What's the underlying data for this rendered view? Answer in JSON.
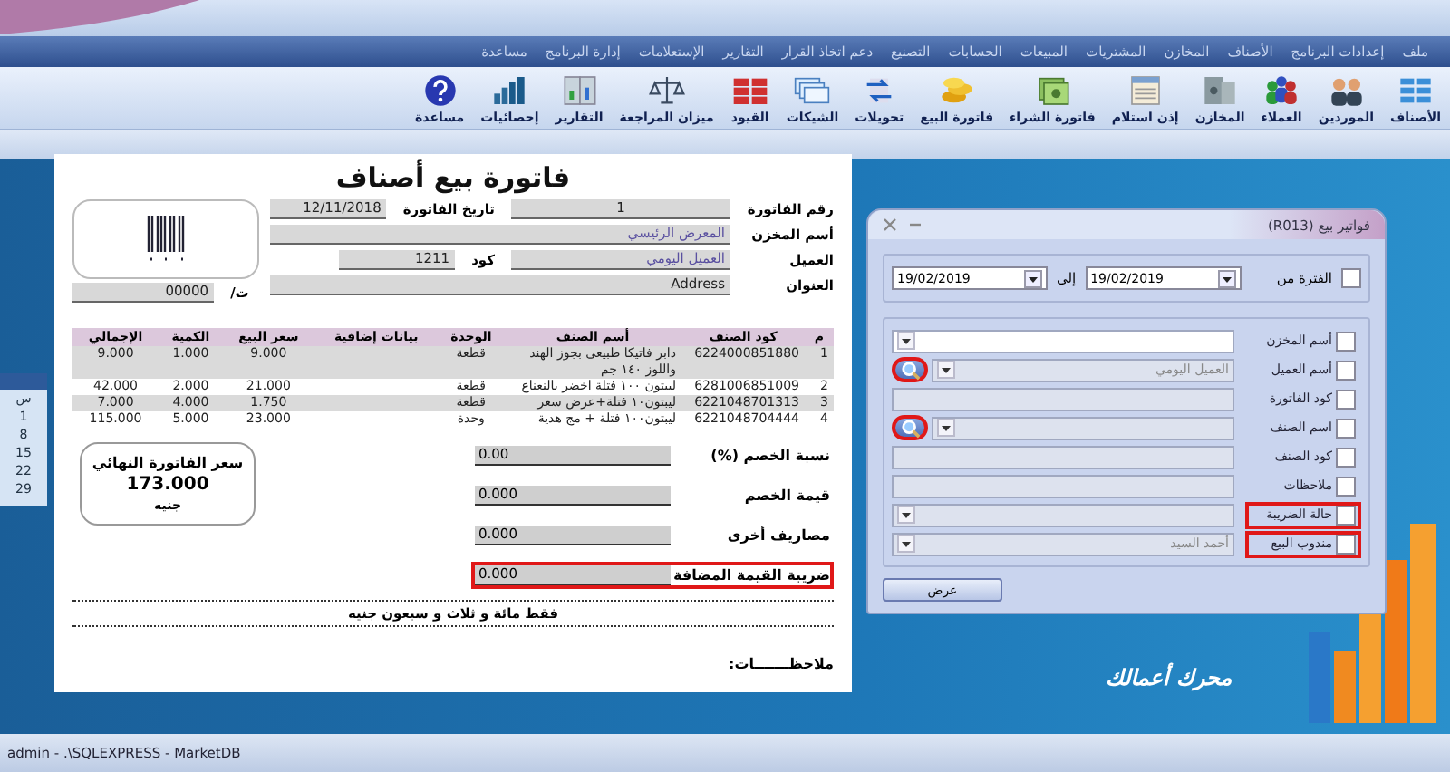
{
  "menu_bar": {
    "items": [
      "ملف",
      "إعدادات البرنامج",
      "الأصناف",
      "المخازن",
      "المشتريات",
      "المبيعات",
      "الحسابات",
      "التصنيع",
      "دعم اتخاذ القرار",
      "التقارير",
      "الإستعلامات",
      "إدارة البرنامج",
      "مساعدة"
    ]
  },
  "toolbar": {
    "buttons": [
      {
        "label": "الأصناف"
      },
      {
        "label": "الموردين"
      },
      {
        "label": "العملاء"
      },
      {
        "label": "المخازن"
      },
      {
        "label": "إذن استلام"
      },
      {
        "label": "فاتورة الشراء"
      },
      {
        "label": "فاتورة البيع"
      },
      {
        "label": "تحويلات"
      },
      {
        "label": "الشيكات"
      },
      {
        "label": "القيود"
      },
      {
        "label": "ميزان المراجعة"
      },
      {
        "label": "التقارير"
      },
      {
        "label": "إحصائيات"
      },
      {
        "label": "مساعدة"
      }
    ]
  },
  "calendar_strip": {
    "texts": [
      "س",
      "1",
      "8",
      "15",
      "22",
      "29"
    ]
  },
  "invoice": {
    "title": "فاتورة بيع أصناف",
    "number_label": "رقم الفاتورة",
    "number": "1",
    "date_label": "تاريخ الفاتورة",
    "date": "12/11/2018",
    "store_label": "أسم المخزن",
    "store": "المعرض الرئيسي",
    "customer_label": "العميل",
    "customer": "العميل اليومي",
    "code_label": "كود",
    "code": "1211",
    "address_label": "العنوان",
    "address": "Address",
    "phone_label": "ت/",
    "phone": "00000",
    "table": {
      "columns": [
        "م",
        "كود الصنف",
        "أسم الصنف",
        "الوحدة",
        "بيانات إضافية",
        "سعر البيع",
        "الكمية",
        "الإجمالي"
      ],
      "rows": [
        {
          "shaded": true,
          "cells": [
            "1",
            "6224000851880",
            "دابر فاتيكا طبيعى بجوز الهند واللوز ١٤٠ جم",
            "قطعة",
            "",
            "9.000",
            "1.000",
            "9.000"
          ]
        },
        {
          "shaded": false,
          "cells": [
            "2",
            "6281006851009",
            "ليبتون ١٠٠ فتلة اخضر بالنعناع",
            "قطعة",
            "",
            "21.000",
            "2.000",
            "42.000"
          ]
        },
        {
          "shaded": true,
          "cells": [
            "3",
            "6221048701313",
            "ليبتون١٠ فتلة+عرض سعر",
            "قطعة",
            "",
            "1.750",
            "4.000",
            "7.000"
          ]
        },
        {
          "shaded": false,
          "cells": [
            "4",
            "6221048704444",
            "ليبتون١٠٠ فتلة + مج هدية",
            "وحدة",
            "",
            "23.000",
            "5.000",
            "115.000"
          ]
        }
      ]
    },
    "total": {
      "label": "سعر الفاتورة النهائي",
      "amount": "173.000",
      "currency": "جنيه"
    },
    "summary": [
      {
        "label": "نسبة الخصم (%)",
        "value": "0.00",
        "highlighted": false
      },
      {
        "label": "قيمة الخصم",
        "value": "0.000",
        "highlighted": false
      },
      {
        "label": "مصاريف أخرى",
        "value": "0.000",
        "highlighted": false
      },
      {
        "label": "ضريبة القيمة المضافة",
        "value": "0.000",
        "highlighted": true
      }
    ],
    "amount_in_words": "فقط مائة و ثلاث و سبعون جنيه",
    "notes_label": "ملاحظـــــــات:"
  },
  "dialog": {
    "title": "فواتير بيع (R013)",
    "period": {
      "label": "الفترة من",
      "checked": false,
      "from": "19/02/2019",
      "to_label": "إلى",
      "to": "19/02/2019"
    },
    "filters": [
      {
        "label": "أسم المخزن",
        "checked": false,
        "kind": "dropdown",
        "disabled": false,
        "highlighted": false
      },
      {
        "label": "أسم العميل",
        "checked": false,
        "kind": "search",
        "value": "العميل اليومي",
        "disabled": true,
        "highlighted": false,
        "search_highlighted": true
      },
      {
        "label": "كود الفاتورة",
        "checked": false,
        "kind": "text",
        "disabled": true,
        "highlighted": false
      },
      {
        "label": "اسم الصنف",
        "checked": false,
        "kind": "search",
        "disabled": true,
        "highlighted": false,
        "search_highlighted": true
      },
      {
        "label": "كود الصنف",
        "checked": false,
        "kind": "text",
        "disabled": true,
        "highlighted": false
      },
      {
        "label": "ملاحظات",
        "checked": false,
        "kind": "text",
        "disabled": true,
        "highlighted": false
      },
      {
        "label": "حالة الضريبة",
        "checked": false,
        "kind": "dropdown",
        "disabled": true,
        "highlighted": true
      },
      {
        "label": "مندوب البيع",
        "checked": false,
        "kind": "dropdown",
        "value": "أحمد السيد",
        "disabled": true,
        "highlighted": true
      }
    ],
    "button": "عرض"
  },
  "logo": {
    "text": "محرك أعمالك"
  },
  "status_bar": {
    "text": "admin - .\\SQLEXPRESS - MarketDB"
  }
}
